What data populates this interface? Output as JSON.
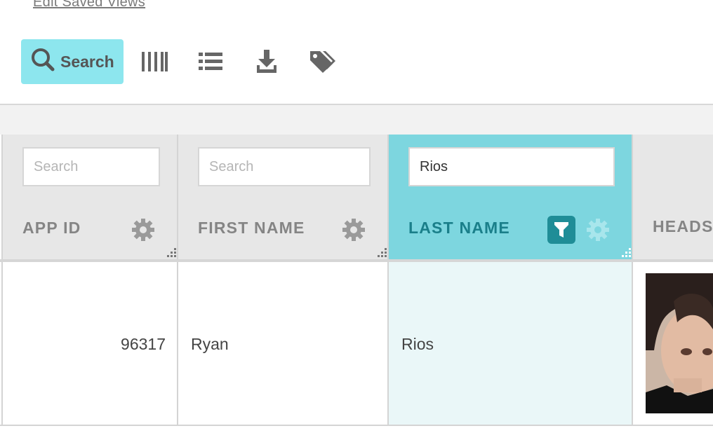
{
  "header": {
    "saved_views_link": "Edit Saved Views"
  },
  "toolbar": {
    "search_label": "Search",
    "icons": [
      "search-icon",
      "columns-icon",
      "list-icon",
      "download-icon",
      "tags-icon"
    ],
    "accent_color": "#8de6ee"
  },
  "table": {
    "columns": [
      {
        "title": "APP ID",
        "filter_placeholder": "Search",
        "filter_value": ""
      },
      {
        "title": "FIRST NAME",
        "filter_placeholder": "Search",
        "filter_value": ""
      },
      {
        "title": "LAST NAME",
        "filter_placeholder": "Search",
        "filter_value": "Rios",
        "filtered": true
      },
      {
        "title": "HEADS"
      }
    ],
    "rows": [
      {
        "app_id": "96317",
        "first_name": "Ryan",
        "last_name": "Rios",
        "headshot": "portrait-photo"
      }
    ],
    "active_color": "#7dd6df",
    "filter_badge_color": "#1f8d97"
  }
}
